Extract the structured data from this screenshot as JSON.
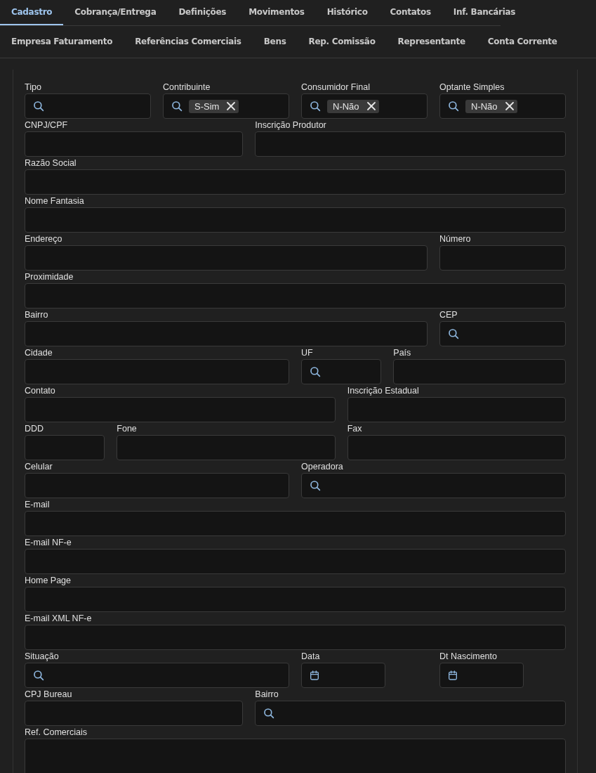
{
  "tabs": [
    {
      "label": "Cadastro",
      "selected": true
    },
    {
      "label": "Cobrança/Entrega",
      "selected": false
    },
    {
      "label": "Definições",
      "selected": false
    },
    {
      "label": "Movimentos",
      "selected": false
    },
    {
      "label": "Histórico",
      "selected": false
    },
    {
      "label": "Contatos",
      "selected": false
    },
    {
      "label": "Inf. Bancárias",
      "selected": false
    }
  ],
  "subtabs": [
    {
      "label": "Empresa Faturamento",
      "selected": false
    },
    {
      "label": "Referências Comerciais",
      "selected": false
    },
    {
      "label": "Bens",
      "selected": false
    },
    {
      "label": "Rep. Comissão",
      "selected": false
    },
    {
      "label": "Representante",
      "selected": false
    },
    {
      "label": "Conta Corrente",
      "selected": false
    }
  ],
  "form_rows": [
    [
      {
        "label": "Tipo",
        "kind": "search"
      },
      {
        "label": "Contribuinte",
        "kind": "search",
        "tag": "S-Sim"
      },
      {
        "label": "Consumidor Final",
        "kind": "search",
        "tag": "N-Não"
      },
      {
        "label": "Optante Simples",
        "kind": "search",
        "tag": "N-Não"
      }
    ],
    [
      {
        "label": "CNPJ/CPF",
        "kind": "text"
      },
      {
        "label": "Inscrição Produtor",
        "kind": "text"
      }
    ],
    [
      {
        "label": "Razão Social",
        "kind": "text"
      }
    ],
    [
      {
        "label": "Nome Fantasia",
        "kind": "text"
      }
    ],
    [
      {
        "label": "Endereço",
        "kind": "text"
      },
      {
        "label": "Número",
        "kind": "text"
      }
    ],
    [
      {
        "label": "Proximidade",
        "kind": "text"
      }
    ],
    [
      {
        "label": "Bairro",
        "kind": "text"
      },
      {
        "label": "CEP",
        "kind": "search"
      }
    ],
    [
      {
        "label": "Cidade",
        "kind": "text"
      },
      {
        "label": "UF",
        "kind": "search"
      },
      {
        "label": "País",
        "kind": "text"
      }
    ],
    [
      {
        "label": "Contato",
        "kind": "text"
      },
      {
        "label": "Inscrição Estadual",
        "kind": "text"
      }
    ],
    [
      {
        "label": "DDD",
        "kind": "text"
      },
      {
        "label": "Fone",
        "kind": "text"
      },
      {
        "label": "Fax",
        "kind": "text"
      }
    ],
    [
      {
        "label": "Celular",
        "kind": "text"
      },
      {
        "label": "Operadora",
        "kind": "search"
      }
    ],
    [
      {
        "label": "E-mail",
        "kind": "text"
      }
    ],
    [
      {
        "label": "E-mail NF-e",
        "kind": "text"
      }
    ],
    [
      {
        "label": "Home Page",
        "kind": "text"
      }
    ],
    [
      {
        "label": "E-mail XML NF-e",
        "kind": "text"
      }
    ],
    [
      {
        "label": "Situação",
        "kind": "search"
      },
      {
        "label": "Data",
        "kind": "date"
      },
      {
        "label": "Dt Nascimento",
        "kind": "date"
      }
    ],
    [
      {
        "label": "CPJ Bureau",
        "kind": "text"
      },
      {
        "label": "Bairro",
        "kind": "search"
      }
    ],
    [
      {
        "label": "Ref. Comerciais",
        "kind": "textarea"
      }
    ]
  ]
}
